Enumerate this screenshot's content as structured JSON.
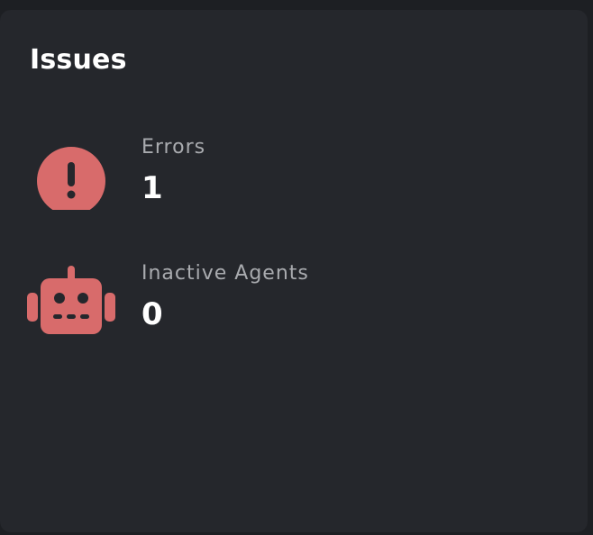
{
  "card": {
    "title": "Issues"
  },
  "metrics": [
    {
      "label": "Errors",
      "value": "1",
      "icon": "error-exclamation-icon"
    },
    {
      "label": "Inactive Agents",
      "value": "0",
      "icon": "robot-icon"
    }
  ],
  "colors": {
    "background": "#1d1f23",
    "card": "#25272c",
    "accent": "#d86b6b",
    "title": "#ffffff",
    "label": "#a9abaf"
  }
}
